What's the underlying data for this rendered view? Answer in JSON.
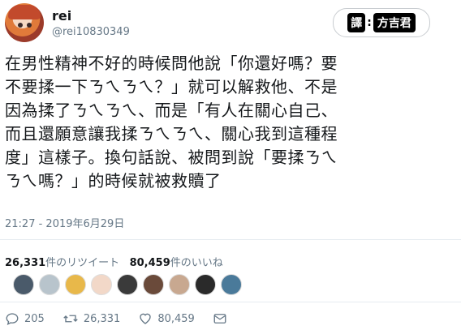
{
  "user": {
    "name": "rei",
    "handle": "@rei10830349"
  },
  "follow_button": {
    "badge_left": "譯",
    "separator": ":",
    "badge_right": "方吉君"
  },
  "tweet": {
    "lines": [
      "在男性精神不好的時候問他說「你還好嗎？要",
      "不要揉一下ㄋㄟㄋㄟ？」就可以解救他、不是",
      "因為揉了ㄋㄟㄋㄟ、而是「有人在關心自己、",
      "而且還願意讓我揉ㄋㄟㄋㄟ、關心我到這種程",
      "度」這樣子。換句話說、被問到說「要揉ㄋㄟ",
      "ㄋㄟ嗎？」的時候就被救贖了"
    ],
    "timestamp": "21:27 - 2019年6月29日"
  },
  "stats": {
    "retweets_count": "26,331",
    "retweets_label": "件のリツイート",
    "likes_count": "80,459",
    "likes_label": "件のいいね"
  },
  "likers": [
    {
      "color": "#4a5a6a"
    },
    {
      "color": "#b8c4cc"
    },
    {
      "color": "#e8b84a"
    },
    {
      "color": "#f2d8c8"
    },
    {
      "color": "#3a3a3a"
    },
    {
      "color": "#6a4a3a"
    },
    {
      "color": "#c8a890"
    },
    {
      "color": "#2a2a2a"
    },
    {
      "color": "#4a7a9a"
    }
  ],
  "actions": {
    "replies": "205",
    "retweets": "26,331",
    "likes": "80,459"
  }
}
